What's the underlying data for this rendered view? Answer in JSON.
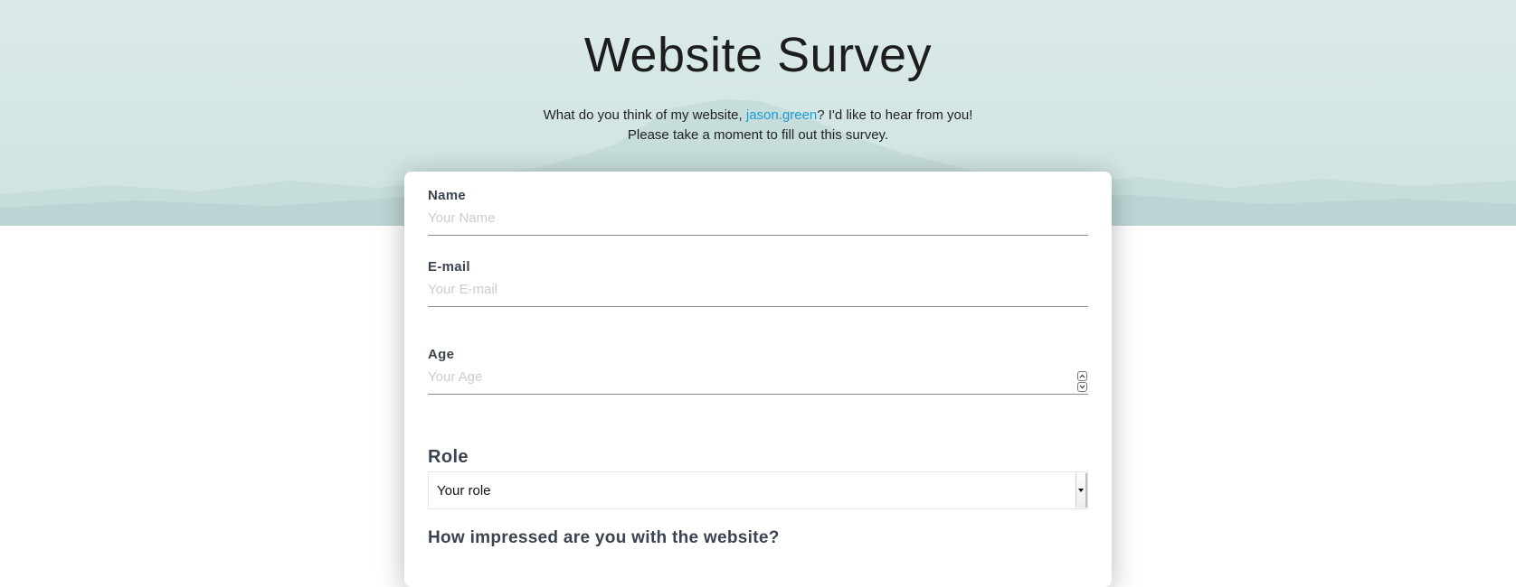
{
  "header": {
    "title": "Website Survey",
    "intro_prefix": "What do you think of my website, ",
    "username": "jason.green",
    "intro_suffix": "? I'd like to hear from you!",
    "intro_line2": "Please take a moment to fill out this survey."
  },
  "form": {
    "name": {
      "label": "Name",
      "placeholder": "Your Name",
      "value": ""
    },
    "email": {
      "label": "E-mail",
      "placeholder": "Your E-mail",
      "value": ""
    },
    "age": {
      "label": "Age",
      "placeholder": "Your Age",
      "value": ""
    },
    "role": {
      "title": "Role",
      "selected": "Your role"
    },
    "question": "How impressed are you with the website?"
  },
  "icons": {
    "spin_up": "chevron-up-icon",
    "spin_down": "chevron-down-icon",
    "select_arrow": "caret-down-icon"
  },
  "colors": {
    "link": "#1a9bd7",
    "hero_bg": "#d3e6e5",
    "label": "#3a4450"
  }
}
